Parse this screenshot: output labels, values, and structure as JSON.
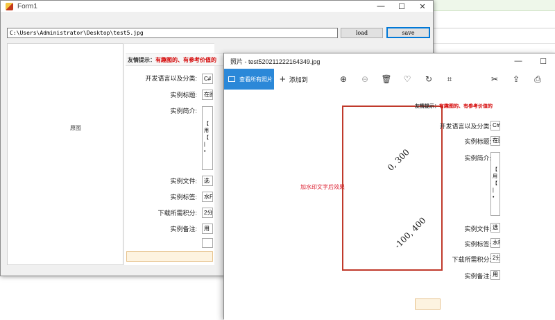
{
  "form1": {
    "title": "Form1",
    "win": {
      "minimize": "—",
      "maximize": "☐",
      "close": "✕"
    },
    "path_value": "C:\\Users\\Administrator\\Desktop\\test5.jpg",
    "load_label": "load",
    "save_label": "save",
    "picture_label": "原图",
    "web": {
      "tip_prefix": "友情提示：",
      "tip_red": "有趣图的、有参考价值的",
      "fields": [
        {
          "label": "开发语言以及分类:",
          "value": "C#"
        },
        {
          "label": "实例标题:",
          "value": "在图"
        },
        {
          "label": "实例简介:",
          "value": ""
        },
        {
          "label": "实例文件:",
          "value": "选"
        },
        {
          "label": "实例标签:",
          "value": "水F"
        },
        {
          "label": "下载所需积分:",
          "value": "2分"
        },
        {
          "label": "实例备注:",
          "value": "用"
        }
      ],
      "textarea_lines": [
        "【",
        "用",
        "【",
        "|",
        "•"
      ]
    }
  },
  "photos": {
    "title": "照片 - test520211222164349.jpg",
    "win": {
      "minimize": "—",
      "maximize": "☐"
    },
    "toolbar": {
      "view_all": "查看所有照片",
      "add_to": "添加到"
    },
    "watermark_label": "加水印文字后效果",
    "watermark_text_1": "0, 300",
    "watermark_text_2": "-100, 400",
    "inner": {
      "tip_prefix": "友情提示：",
      "tip_red": "有趣图的、有参考价值的",
      "fields": [
        {
          "label": "开发语言以及分类:",
          "value": "C#"
        },
        {
          "label": "实例标题:",
          "value": "在图"
        },
        {
          "label": "实例简介:",
          "value": ""
        },
        {
          "label": "实例文件:",
          "value": "选"
        },
        {
          "label": "实例标签:",
          "value": "水F"
        },
        {
          "label": "下载所需积分:",
          "value": "2分"
        },
        {
          "label": "实例备注:",
          "value": "用"
        }
      ],
      "textarea_lines": [
        "【",
        "用",
        "【",
        "|",
        "•"
      ]
    }
  },
  "icons": [
    "app-icon",
    "zoom-in-icon",
    "zoom-out-icon",
    "delete-icon",
    "heart-icon",
    "rotate-icon",
    "crop-icon",
    "edit-icon",
    "share-icon",
    "print-icon"
  ]
}
